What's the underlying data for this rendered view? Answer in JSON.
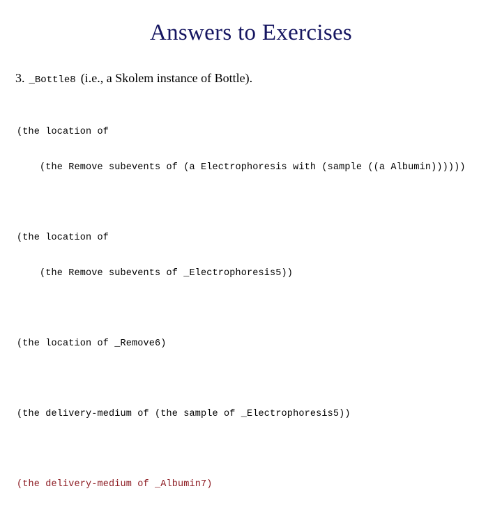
{
  "slide": {
    "title": "Answers to Exercises",
    "title_color": "#151560",
    "background_color": "#ffffff"
  },
  "answer": {
    "number": "3.",
    "term": "_Bottle8",
    "gloss": "(i.e., a Skolem instance of Bottle)."
  },
  "code_blocks": [
    {
      "color": "#000000",
      "lines": [
        "(the location of",
        "    (the Remove subevents of (a Electrophoresis with (sample ((a Albumin))))))"
      ]
    },
    {
      "color": "#000000",
      "lines": [
        "(the location of",
        "    (the Remove subevents of _Electrophoresis5))"
      ]
    },
    {
      "color": "#000000",
      "lines": [
        "(the location of _Remove6)"
      ]
    },
    {
      "color": "#000000",
      "lines": [
        "(the delivery-medium of (the sample of _Electrophoresis5))"
      ]
    },
    {
      "color": "#8c1a21",
      "lines": [
        "(the delivery-medium of _Albumin7)"
      ]
    }
  ]
}
